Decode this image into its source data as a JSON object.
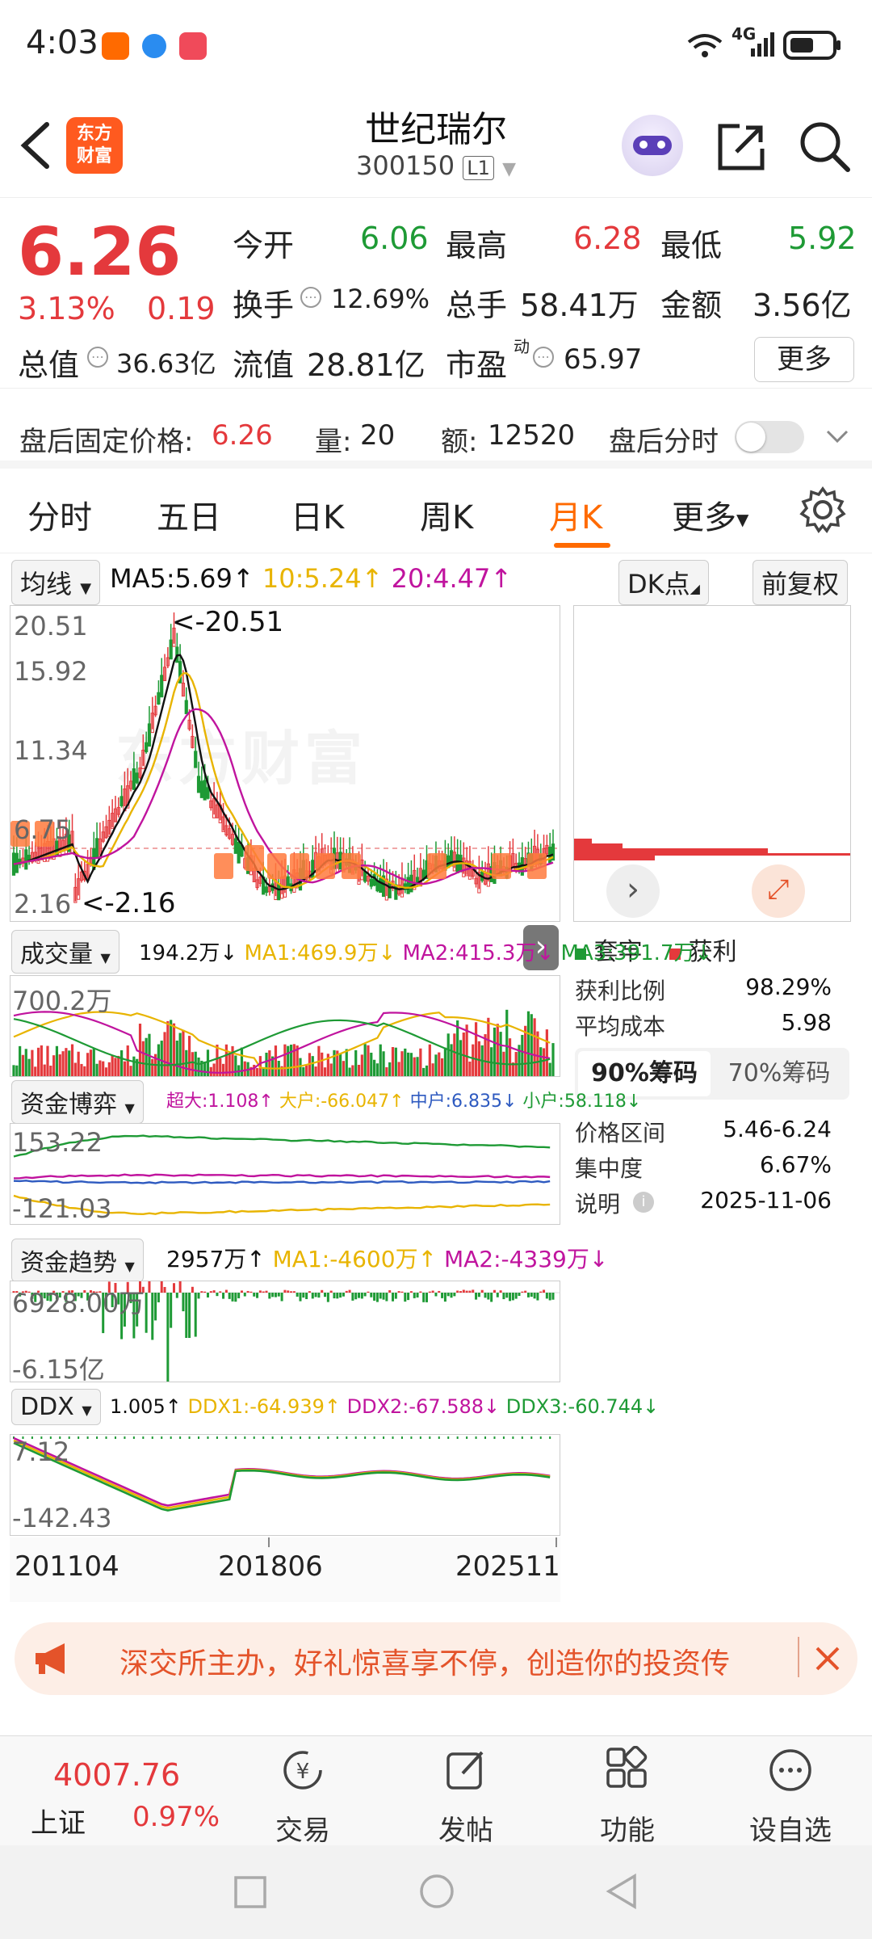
{
  "status_bar": {
    "time": "4:03",
    "network": "4G"
  },
  "header": {
    "stock_name": "世纪瑞尔",
    "stock_code": "300150",
    "level": "L1",
    "logo_text_1": "东方",
    "logo_text_2": "财富"
  },
  "quote": {
    "price": "6.26",
    "change_pct": "3.13%",
    "change_amt": "0.19",
    "open_label": "今开",
    "open": "6.06",
    "high_label": "最高",
    "high": "6.28",
    "low_label": "最低",
    "low": "5.92",
    "turnover_label": "换手",
    "turnover": "12.69%",
    "volume_label": "总手",
    "volume": "58.41万",
    "amount_label": "金额",
    "amount": "3.56亿",
    "mktcap_label": "总值",
    "mktcap": "36.63亿",
    "float_label": "流值",
    "float": "28.81亿",
    "pe_label": "市盈",
    "pe_sup": "动",
    "pe": "65.97",
    "more_label": "更多"
  },
  "after_hours": {
    "price_label": "盘后固定价格:",
    "price": "6.26",
    "vol_label": "量:",
    "vol": "20",
    "amt_label": "额:",
    "amt": "12520",
    "minute_label": "盘后分时"
  },
  "tabs": {
    "items": [
      "分时",
      "五日",
      "日K",
      "周K",
      "月K",
      "更多"
    ],
    "active": "月K"
  },
  "chart": {
    "ma_selector": "均线",
    "ma5": "MA5:5.69↑",
    "ma10": "10:5.24↑",
    "ma20": "20:4.47↑",
    "dk_label": "DK点",
    "fq_label": "前复权",
    "price_axis": [
      "20.51",
      "15.92",
      "11.34",
      "6.75",
      "2.16"
    ],
    "max_marker": "<-20.51",
    "min_marker": "<-2.16",
    "watermark": "东方财富",
    "vol_selector": "成交量",
    "vol_ind": [
      "194.2万↓",
      "MA1:469.9万↓",
      "MA2:415.3万↓",
      "MA3:391.7万↓"
    ],
    "vol_axis": "700.2万",
    "fund_selector": "资金博弈",
    "fund_ind": [
      "超大:1.108↑",
      "大户:-66.047↑",
      "中户:6.835↓",
      "小户:58.118↓"
    ],
    "fund_axis": [
      "153.22",
      "-121.03"
    ],
    "trend_selector": "资金趋势",
    "trend_ind": [
      "2957万↑",
      "MA1:-4600万↑",
      "MA2:-4339万↓"
    ],
    "trend_axis": [
      "6928.00万",
      "-6.15亿"
    ],
    "ddx_selector": "DDX",
    "ddx_ind": [
      "1.005↑",
      "DDX1:-64.939↑",
      "DDX2:-67.588↓",
      "DDX3:-60.744↓"
    ],
    "ddx_axis": [
      "7.12",
      "-142.43"
    ],
    "dates": [
      "201104",
      "201806",
      "202511"
    ],
    "colors": {
      "ma5": "#111111",
      "ma10": "#e8b400",
      "ma20": "#c0149e",
      "up": "#e4393c",
      "down": "#1e9a35",
      "blue": "#2e5ac0"
    }
  },
  "chips": {
    "legend_trapped": "套牢",
    "legend_profit": "获利",
    "profit_ratio_label": "获利比例",
    "profit_ratio": "98.29%",
    "avg_cost_label": "平均成本",
    "avg_cost": "5.98",
    "tab_90": "90%筹码",
    "tab_70": "70%筹码",
    "range_label": "价格区间",
    "range": "5.46-6.24",
    "concentration_label": "集中度",
    "concentration": "6.67%",
    "note_label": "说明",
    "note_date": "2025-11-06"
  },
  "banner": {
    "text": "深交所主办，好礼惊喜享不停，创造你的投资传"
  },
  "bottom_nav": {
    "index_value": "4007.76",
    "index_name": "上证",
    "index_change": "0.97%",
    "trade": "交易",
    "post": "发帖",
    "functions": "功能",
    "watchlist": "设自选"
  }
}
